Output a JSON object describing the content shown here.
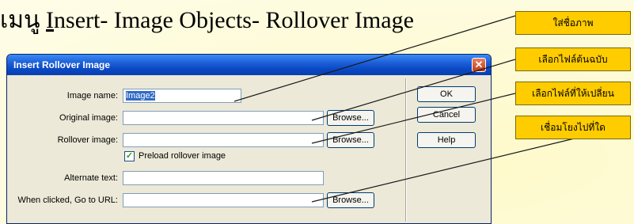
{
  "slide": {
    "title_pre": "เมนู ",
    "title_underlined": "I",
    "title_post": "nsert- Image Objects- Rollover Image"
  },
  "dialog": {
    "title": "Insert Rollover Image",
    "close_glyph": "✕",
    "fields": {
      "image_name": {
        "label": "Image name:",
        "value": "Image2"
      },
      "original_image": {
        "label": "Original image:",
        "value": ""
      },
      "rollover_image": {
        "label": "Rollover image:",
        "value": ""
      },
      "preload": {
        "label": "Preload rollover image",
        "checked": true
      },
      "alternate_text": {
        "label": "Alternate text:",
        "value": ""
      },
      "go_to_url": {
        "label": "When clicked, Go to URL:",
        "value": ""
      }
    },
    "buttons": {
      "browse": "Browse...",
      "ok": "OK",
      "cancel": "Cancel",
      "help": "Help"
    }
  },
  "callouts": [
    {
      "text": "ใส่ชื่อภาพ"
    },
    {
      "text": "เลือกไฟล์ต้นฉบับ"
    },
    {
      "text": "เลือกไฟล์ที่ให้เปลี่ยน"
    },
    {
      "text": "เชื่อมโยงไปที่ใด"
    }
  ],
  "colors": {
    "callout_fill": "#ffcc00",
    "title_bar": "#0a49c4",
    "dialog_face": "#ece9d8"
  }
}
